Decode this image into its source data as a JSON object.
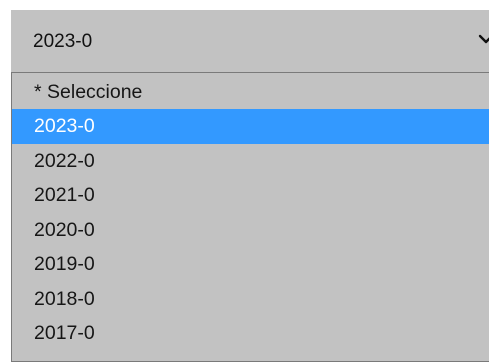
{
  "select": {
    "value": "2023-0",
    "options": [
      {
        "label": "* Seleccione",
        "selected": false
      },
      {
        "label": "2023-0",
        "selected": true
      },
      {
        "label": "2022-0",
        "selected": false
      },
      {
        "label": "2021-0",
        "selected": false
      },
      {
        "label": "2020-0",
        "selected": false
      },
      {
        "label": "2019-0",
        "selected": false
      },
      {
        "label": "2018-0",
        "selected": false
      },
      {
        "label": "2017-0",
        "selected": false
      }
    ]
  },
  "icons": {
    "dropdown_arrow": "chevron-down-icon"
  },
  "colors": {
    "background": "#c2c2c2",
    "selected": "#3399ff"
  }
}
